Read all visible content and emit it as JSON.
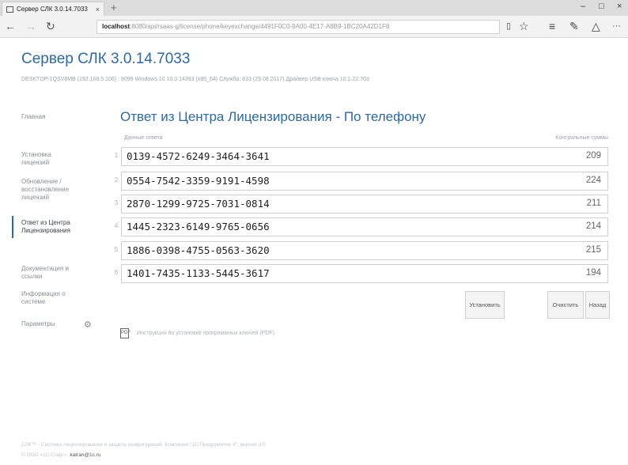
{
  "browser": {
    "tab_title": "Сервер СЛК 3.0.14.7033",
    "tab_close": "×",
    "new_tab": "+",
    "win_minimize": "–",
    "win_maximize": "□",
    "win_close": "×",
    "nav_back": "←",
    "nav_forward": "→",
    "nav_refresh": "↻",
    "address_host": "localhost",
    "address_path": ":8080/api/rsaas-g/license/phone/keyexchange/4491F0C0-9A00-4E17-A8B9-1BC20A42D1F8",
    "icon_reading": "▯",
    "icon_favorite": "☆",
    "icon_hub": "≡",
    "icon_notes": "✎",
    "icon_share": "△",
    "icon_more": "···"
  },
  "app": {
    "title": "Сервер СЛК 3.0.14.7033",
    "meta": "DESKTOP-1QSV8MB (192.168.5.106) : 9099   Windows 10 10.0.14393 (x86_64)   Служба: 833 (29.08.2017)   Драйвер USB-ключа 10.1.22.703"
  },
  "sidebar": {
    "items": [
      {
        "label": "Главная"
      },
      {
        "label": "Установка лицензий"
      },
      {
        "label": "Обновление / восстановление лицензий"
      },
      {
        "label": "Ответ из Центра Лицензирования"
      },
      {
        "label": "Документация и ссылки"
      },
      {
        "label": "Информация о системе"
      },
      {
        "label": "Параметры"
      }
    ],
    "gear_glyph": "⚙"
  },
  "main": {
    "heading": "Ответ из Центра Лицензирования - По телефону",
    "col_data": "Данные ответа",
    "col_checksum": "Контрольные суммы",
    "rows": [
      {
        "idx": "1",
        "code": "0139-4572-6249-3464-3641",
        "sum": "209"
      },
      {
        "idx": "2",
        "code": "0554-7542-3359-9191-4598",
        "sum": "224"
      },
      {
        "idx": "3",
        "code": "2870-1299-9725-7031-0814",
        "sum": "211"
      },
      {
        "idx": "4",
        "code": "1445-2323-6149-9765-0656",
        "sum": "214"
      },
      {
        "idx": "5",
        "code": "1886-0398-4755-0563-3620",
        "sum": "215"
      },
      {
        "idx": "6",
        "code": "1401-7435-1133-5445-3617",
        "sum": "194"
      }
    ],
    "buttons": {
      "install": "Установить",
      "clear": "Очистить",
      "back": "Назад"
    },
    "pdf_glyph": "PDF",
    "pdf_link": "Инструкция по установке программных ключей (PDF)"
  },
  "footer": {
    "line1": "СЛК™ - Система лицензирования и защиты конфигураций. Компания \"1С:Предприятие 8\", версия 3.0",
    "line2_prefix": "© ООО «1С-Софт»,",
    "line2_email": "katran@1c.ru"
  }
}
